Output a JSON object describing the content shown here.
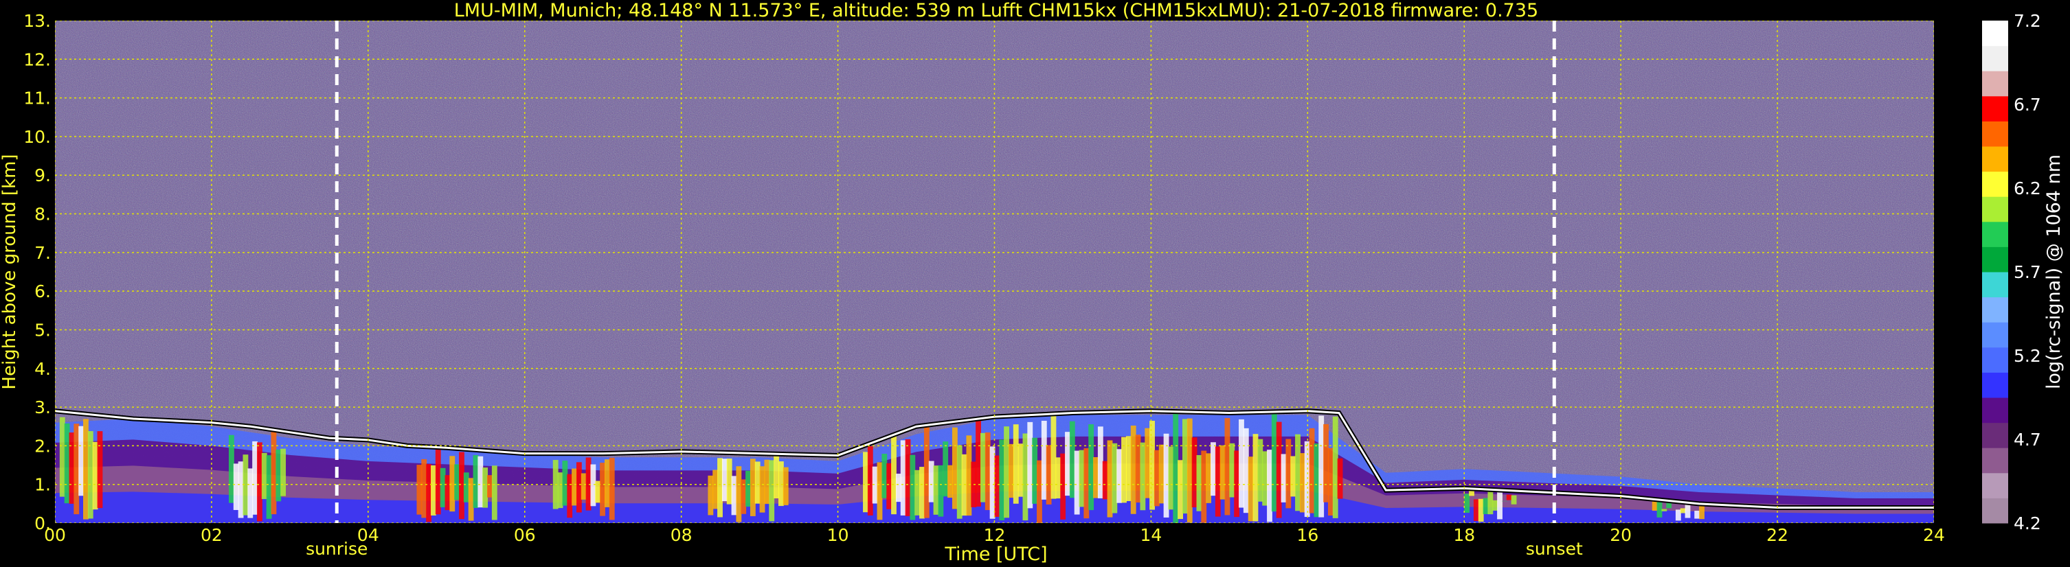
{
  "colors": {
    "background": "#000000",
    "text_yellow": "#ffff33",
    "grid": "#e5e500",
    "marker": "#ffffff",
    "noise_base": "#6d5a9c"
  },
  "chart_data": {
    "type": "heatmap",
    "title": "LMU-MIM, Munich; 48.148° N 11.573° E, altitude: 539 m    Lufft CHM15kx (CHM15kxLMU): 21-07-2018    firmware: 0.735",
    "xlabel": "Time [UTC]",
    "ylabel": "Height above ground [km]",
    "x_range": [
      0,
      24
    ],
    "y_range": [
      0,
      13
    ],
    "x_ticks": [
      "00",
      "02",
      "04",
      "06",
      "08",
      "10",
      "12",
      "14",
      "16",
      "18",
      "20",
      "22",
      "24"
    ],
    "y_ticks": [
      "0.",
      "1.",
      "2.",
      "3.",
      "4.",
      "5.",
      "6.",
      "7.",
      "8.",
      "9.",
      "10.",
      "11.",
      "12.",
      "13."
    ],
    "grid": true,
    "markers": [
      {
        "label": "sunrise",
        "time_hours": 3.6
      },
      {
        "label": "sunset",
        "time_hours": 19.15
      }
    ],
    "colorbar": {
      "label": "log(rc-signal) @ 1064 nm",
      "range": [
        4.2,
        7.2
      ],
      "ticks": [
        "4.2",
        "4.7",
        "5.2",
        "5.7",
        "6.2",
        "6.7",
        "7.2"
      ],
      "colors": [
        "#a58aa5",
        "#b79ab8",
        "#8f5b90",
        "#6a2c79",
        "#5b0d8a",
        "#3333ff",
        "#4b6cff",
        "#5b8dff",
        "#7fb3ff",
        "#3dd6d6",
        "#00a83a",
        "#22cc55",
        "#aaee33",
        "#ffff33",
        "#ffb300",
        "#ff6600",
        "#ff0000",
        "#e0b0b0",
        "#f0f0f0",
        "#ffffff"
      ]
    },
    "cloud_base_km": [
      [
        0.0,
        2.9
      ],
      [
        0.5,
        2.8
      ],
      [
        1.0,
        2.7
      ],
      [
        1.5,
        2.65
      ],
      [
        2.0,
        2.6
      ],
      [
        2.5,
        2.5
      ],
      [
        3.0,
        2.35
      ],
      [
        3.5,
        2.2
      ],
      [
        4.0,
        2.15
      ],
      [
        4.5,
        2.0
      ],
      [
        5.0,
        1.95
      ],
      [
        6.0,
        1.8
      ],
      [
        7.0,
        1.8
      ],
      [
        8.0,
        1.85
      ],
      [
        9.0,
        1.8
      ],
      [
        10.0,
        1.75
      ],
      [
        11.0,
        2.5
      ],
      [
        12.0,
        2.75
      ],
      [
        13.0,
        2.85
      ],
      [
        14.0,
        2.9
      ],
      [
        15.0,
        2.85
      ],
      [
        16.0,
        2.9
      ],
      [
        16.4,
        2.85
      ],
      [
        17.0,
        0.85
      ],
      [
        18.0,
        0.9
      ],
      [
        19.0,
        0.8
      ],
      [
        20.0,
        0.7
      ],
      [
        21.0,
        0.5
      ],
      [
        22.0,
        0.4
      ],
      [
        23.0,
        0.4
      ],
      [
        24.0,
        0.4
      ]
    ],
    "aerosol_top_km": [
      [
        0.0,
        2.6
      ],
      [
        1.0,
        2.7
      ],
      [
        2.0,
        2.5
      ],
      [
        3.0,
        2.2
      ],
      [
        4.0,
        2.0
      ],
      [
        5.0,
        1.9
      ],
      [
        6.0,
        1.8
      ],
      [
        7.0,
        1.7
      ],
      [
        8.0,
        1.7
      ],
      [
        9.0,
        1.7
      ],
      [
        10.0,
        1.6
      ],
      [
        11.0,
        2.3
      ],
      [
        12.0,
        2.7
      ],
      [
        13.0,
        2.8
      ],
      [
        14.0,
        2.8
      ],
      [
        15.0,
        2.8
      ],
      [
        16.0,
        2.8
      ],
      [
        17.0,
        1.3
      ],
      [
        18.0,
        1.4
      ],
      [
        19.0,
        1.3
      ],
      [
        20.0,
        1.2
      ],
      [
        21.0,
        1.0
      ],
      [
        22.0,
        0.9
      ],
      [
        23.0,
        0.8
      ],
      [
        24.0,
        0.8
      ]
    ]
  }
}
